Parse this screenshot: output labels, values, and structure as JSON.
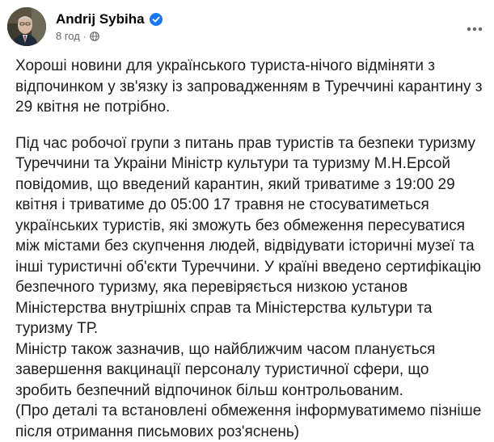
{
  "post": {
    "author": "Andrij Sybiha",
    "time": "8 год",
    "separator": "·",
    "paragraphs": [
      "Хороші новини для українського туриста-нічого відміняти з відпочинком у зв'язку із запровадженням в Туреччині  карантину з 29 квітня не потрібно.",
      "Під час робочої групи з питань прав туристів та безпеки туризму Туреччини та Украіни Міністр культури та туризму М.Н.Ерсой повідомив, що введений карантин, який триватиме з 19:00 29 квітня і триватиме до 05:00 17 травня не стосуватиметься українських туристів, які зможуть без обмеження пересуватися між містами без скупчення людей, відвідувати історичні музеї та інші туристичні об'єкти Туреччини. У країні введено сертифікацію безпечного туризму, яка перевіряється низкою установ Міністерства внутрішніх справ та Міністерства культури та туризму ТР.\nМіністр також зазначив, що найближчим часом планується завершення вакцинації  персоналу туристичної сфери, що зробить безпечний відпочинок більш контрольованим.\n(Про деталі та встановлені обмеження інформуватимемо пізніше після отримання письмових роз'яснень)"
    ],
    "icons": {
      "verified": "verified-badge-icon",
      "audience": "globe-icon",
      "more": "more-options-icon"
    },
    "colors": {
      "verified": "#1877f2",
      "meta": "#65676b",
      "text": "#1c1e21"
    }
  }
}
